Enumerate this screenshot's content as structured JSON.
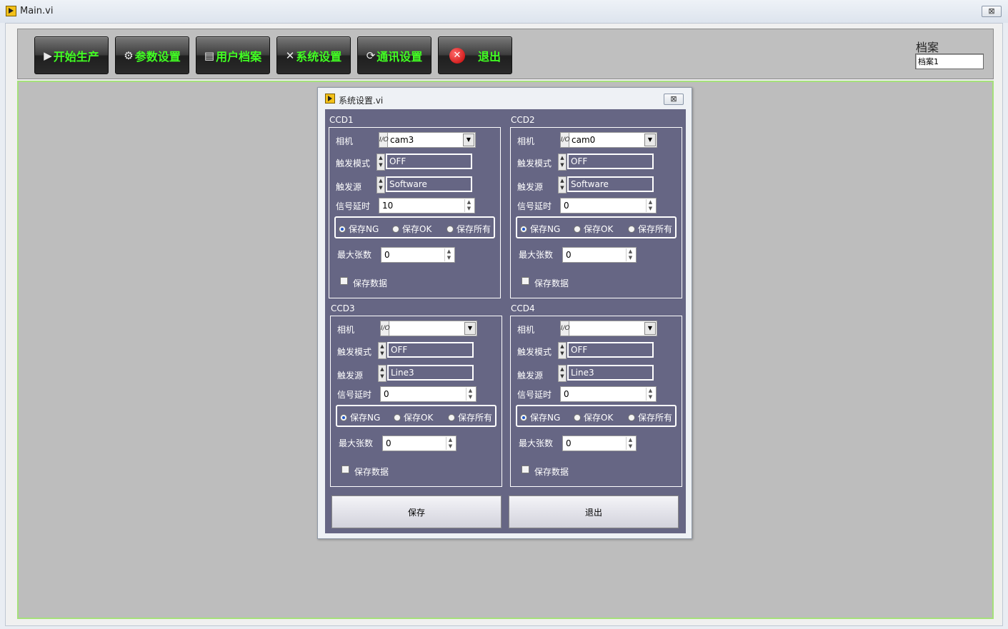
{
  "window": {
    "title": "Main.vi",
    "close_glyph": "⊠"
  },
  "toolbar": {
    "buttons": [
      {
        "label": "开始生产",
        "icon": "play-icon"
      },
      {
        "label": "参数设置",
        "icon": "gear-icon"
      },
      {
        "label": "用户档案",
        "icon": "printer-icon"
      },
      {
        "label": "系统设置",
        "icon": "tools-icon"
      },
      {
        "label": "通讯设置",
        "icon": "refresh-icon"
      },
      {
        "label": "退出",
        "icon": "close-icon"
      }
    ]
  },
  "archive": {
    "label": "档案",
    "value": "档案1"
  },
  "dialog": {
    "title": "系统设置.vi",
    "close_glyph": "⊠",
    "save_button": "保存",
    "exit_button": "退出",
    "ccds": [
      {
        "title": "CCD1",
        "camera_label": "相机",
        "camera_value": "cam3",
        "trigger_mode_label": "触发模式",
        "trigger_mode_value": "OFF",
        "trigger_source_label": "触发源",
        "trigger_source_value": "Software",
        "delay_label": "信号延时",
        "delay_value": "10",
        "radio_ng": "保存NG",
        "radio_ok": "保存OK",
        "radio_all": "保存所有",
        "selected": "ng",
        "max_label": "最大张数",
        "max_value": "0",
        "save_data_label": "保存数据"
      },
      {
        "title": "CCD2",
        "camera_label": "相机",
        "camera_value": "cam0",
        "trigger_mode_label": "触发模式",
        "trigger_mode_value": "OFF",
        "trigger_source_label": "触发源",
        "trigger_source_value": "Software",
        "delay_label": "信号延时",
        "delay_value": "0",
        "radio_ng": "保存NG",
        "radio_ok": "保存OK",
        "radio_all": "保存所有",
        "selected": "ng",
        "max_label": "最大张数",
        "max_value": "0",
        "save_data_label": "保存数据"
      },
      {
        "title": "CCD3",
        "camera_label": "相机",
        "camera_value": "",
        "trigger_mode_label": "触发模式",
        "trigger_mode_value": "OFF",
        "trigger_source_label": "触发源",
        "trigger_source_value": "Line3",
        "delay_label": "信号延时",
        "delay_value": "0",
        "radio_ng": "保存NG",
        "radio_ok": "保存OK",
        "radio_all": "保存所有",
        "selected": "ng",
        "max_label": "最大张数",
        "max_value": "0",
        "save_data_label": "保存数据"
      },
      {
        "title": "CCD4",
        "camera_label": "相机",
        "camera_value": "",
        "trigger_mode_label": "触发模式",
        "trigger_mode_value": "OFF",
        "trigger_source_label": "触发源",
        "trigger_source_value": "Line3",
        "delay_label": "信号延时",
        "delay_value": "0",
        "radio_ng": "保存NG",
        "radio_ok": "保存OK",
        "radio_all": "保存所有",
        "selected": "ng",
        "max_label": "最大张数",
        "max_value": "0",
        "save_data_label": "保存数据"
      }
    ]
  }
}
